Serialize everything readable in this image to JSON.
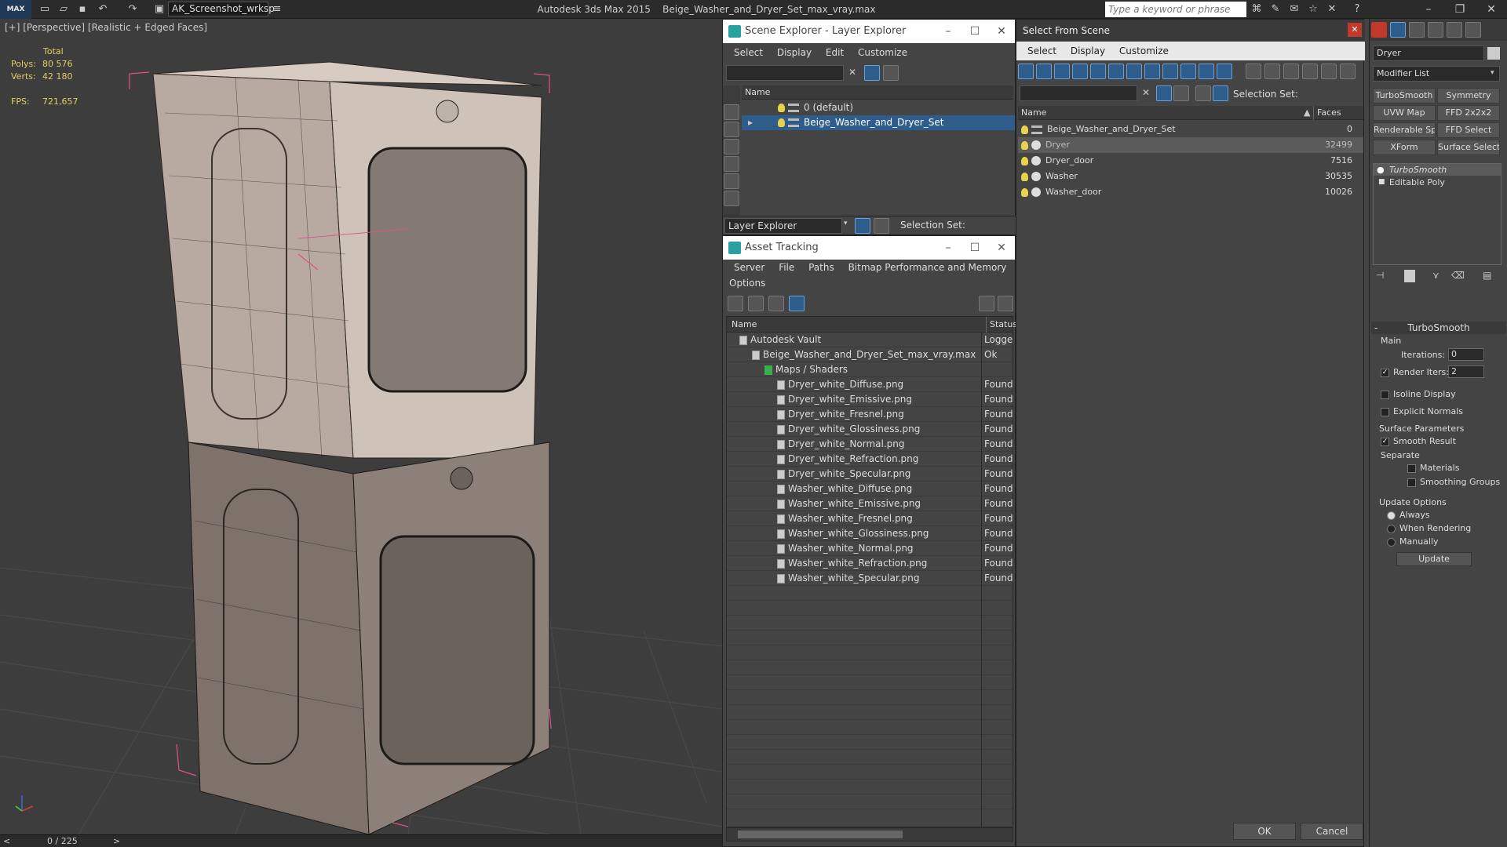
{
  "titlebar": {
    "logo": "MAX",
    "workspace": "AK_Screenshot_wrksp",
    "app_title": "Autodesk 3ds Max 2015",
    "file_title": "Beige_Washer_and_Dryer_Set_max_vray.max",
    "search_placeholder": "Type a keyword or phrase"
  },
  "viewport": {
    "label": "[+] [Perspective] [Realistic + Edged Faces]",
    "stats": {
      "header": "Total",
      "polys_label": "Polys:",
      "polys_value": "80 576",
      "verts_label": "Verts:",
      "verts_value": "42 180",
      "fps_label": "FPS:",
      "fps_value": "721,657"
    },
    "timeline": "0 / 225"
  },
  "scene_explorer": {
    "title": "Scene Explorer - Layer Explorer",
    "menu": [
      "Select",
      "Display",
      "Edit",
      "Customize"
    ],
    "column_name": "Name",
    "layers": [
      "0 (default)",
      "Beige_Washer_and_Dryer_Set"
    ],
    "footer_label": "Layer Explorer",
    "selection_set_label": "Selection Set:"
  },
  "asset_tracking": {
    "title": "Asset Tracking",
    "menu": [
      "Server",
      "File",
      "Paths",
      "Bitmap Performance and Memory"
    ],
    "menu2": "Options",
    "col_name": "Name",
    "col_status": "Status",
    "rows": [
      {
        "name": "Autodesk Vault",
        "status": "Logged",
        "indent": 0
      },
      {
        "name": "Beige_Washer_and_Dryer_Set_max_vray.max",
        "status": "Ok",
        "indent": 1
      },
      {
        "name": "Maps / Shaders",
        "status": "",
        "indent": 2
      },
      {
        "name": "Dryer_white_Diffuse.png",
        "status": "Found",
        "indent": 3
      },
      {
        "name": "Dryer_white_Emissive.png",
        "status": "Found",
        "indent": 3
      },
      {
        "name": "Dryer_white_Fresnel.png",
        "status": "Found",
        "indent": 3
      },
      {
        "name": "Dryer_white_Glossiness.png",
        "status": "Found",
        "indent": 3
      },
      {
        "name": "Dryer_white_Normal.png",
        "status": "Found",
        "indent": 3
      },
      {
        "name": "Dryer_white_Refraction.png",
        "status": "Found",
        "indent": 3
      },
      {
        "name": "Dryer_white_Specular.png",
        "status": "Found",
        "indent": 3
      },
      {
        "name": "Washer_white_Diffuse.png",
        "status": "Found",
        "indent": 3
      },
      {
        "name": "Washer_white_Emissive.png",
        "status": "Found",
        "indent": 3
      },
      {
        "name": "Washer_white_Fresnel.png",
        "status": "Found",
        "indent": 3
      },
      {
        "name": "Washer_white_Glossiness.png",
        "status": "Found",
        "indent": 3
      },
      {
        "name": "Washer_white_Normal.png",
        "status": "Found",
        "indent": 3
      },
      {
        "name": "Washer_white_Refraction.png",
        "status": "Found",
        "indent": 3
      },
      {
        "name": "Washer_white_Specular.png",
        "status": "Found",
        "indent": 3
      }
    ]
  },
  "select_from_scene": {
    "title": "Select From Scene",
    "menu": [
      "Select",
      "Display",
      "Customize"
    ],
    "selection_set_label": "Selection Set:",
    "col_name": "Name",
    "col_faces": "Faces",
    "objects": [
      {
        "name": "Beige_Washer_and_Dryer_Set",
        "faces": "0",
        "selected": false
      },
      {
        "name": "Dryer",
        "faces": "32499",
        "selected": true
      },
      {
        "name": "Dryer_door",
        "faces": "7516",
        "selected": false
      },
      {
        "name": "Washer",
        "faces": "30535",
        "selected": false
      },
      {
        "name": "Washer_door",
        "faces": "10026",
        "selected": false
      }
    ],
    "ok": "OK",
    "cancel": "Cancel"
  },
  "command_panel": {
    "object_name": "Dryer",
    "modifier_list": "Modifier List",
    "buttons": [
      "TurboSmooth",
      "Symmetry",
      "UVW Map",
      "FFD 2x2x2",
      "Renderable Spline",
      "FFD Select",
      "XForm",
      "Surface Select"
    ],
    "stack": [
      "TurboSmooth",
      "Editable Poly"
    ],
    "rollout_title": "TurboSmooth",
    "main_label": "Main",
    "iterations_label": "Iterations:",
    "iterations_value": "0",
    "render_iters_label": "Render Iters:",
    "render_iters_value": "2",
    "isoline_label": "Isoline Display",
    "explicit_normals_label": "Explicit Normals",
    "surface_params_label": "Surface Parameters",
    "smooth_result_label": "Smooth Result",
    "separate_label": "Separate",
    "materials_label": "Materials",
    "smoothing_groups_label": "Smoothing Groups",
    "update_options_label": "Update Options",
    "always_label": "Always",
    "when_rendering_label": "When Rendering",
    "manually_label": "Manually",
    "update_button": "Update"
  },
  "colors": {
    "selection": "#2e5d8c",
    "accent_teal": "#2aa0a0",
    "bbox_pink": "#e0508a",
    "stats_yellow": "#e0d060"
  }
}
